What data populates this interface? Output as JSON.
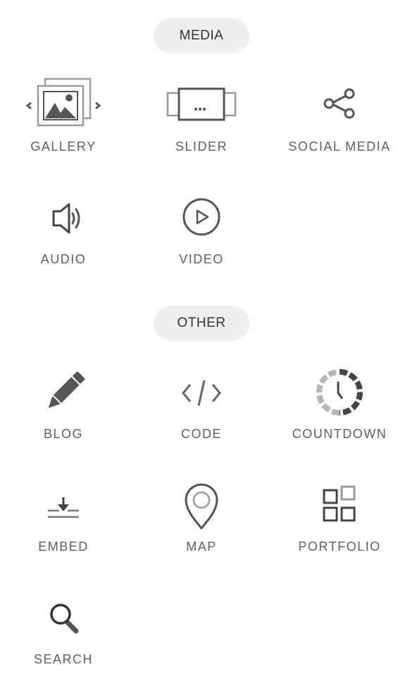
{
  "sections": {
    "media": {
      "title": "MEDIA",
      "items": {
        "gallery": "GALLERY",
        "slider": "SLIDER",
        "social_media": "SOCIAL MEDIA",
        "audio": "AUDIO",
        "video": "VIDEO"
      }
    },
    "other": {
      "title": "OTHER",
      "items": {
        "blog": "BLOG",
        "code": "CODE",
        "countdown": "COUNTDOWN",
        "embed": "EMBED",
        "map": "MAP",
        "portfolio": "PORTFOLIO",
        "search": "SEARCH"
      }
    }
  },
  "icons": {
    "gallery": "gallery-icon",
    "slider": "slider-icon",
    "social_media": "share-icon",
    "audio": "speaker-icon",
    "video": "play-circle-icon",
    "blog": "pencil-icon",
    "code": "code-icon",
    "countdown": "countdown-clock-icon",
    "embed": "embed-icon",
    "map": "map-pin-icon",
    "portfolio": "portfolio-grid-icon",
    "search": "magnifier-icon"
  },
  "colors": {
    "icon": "#555555",
    "icon_light": "#9a9a9a",
    "label": "#606060",
    "pill_background": "#efefef",
    "pill_text": "#333333"
  }
}
